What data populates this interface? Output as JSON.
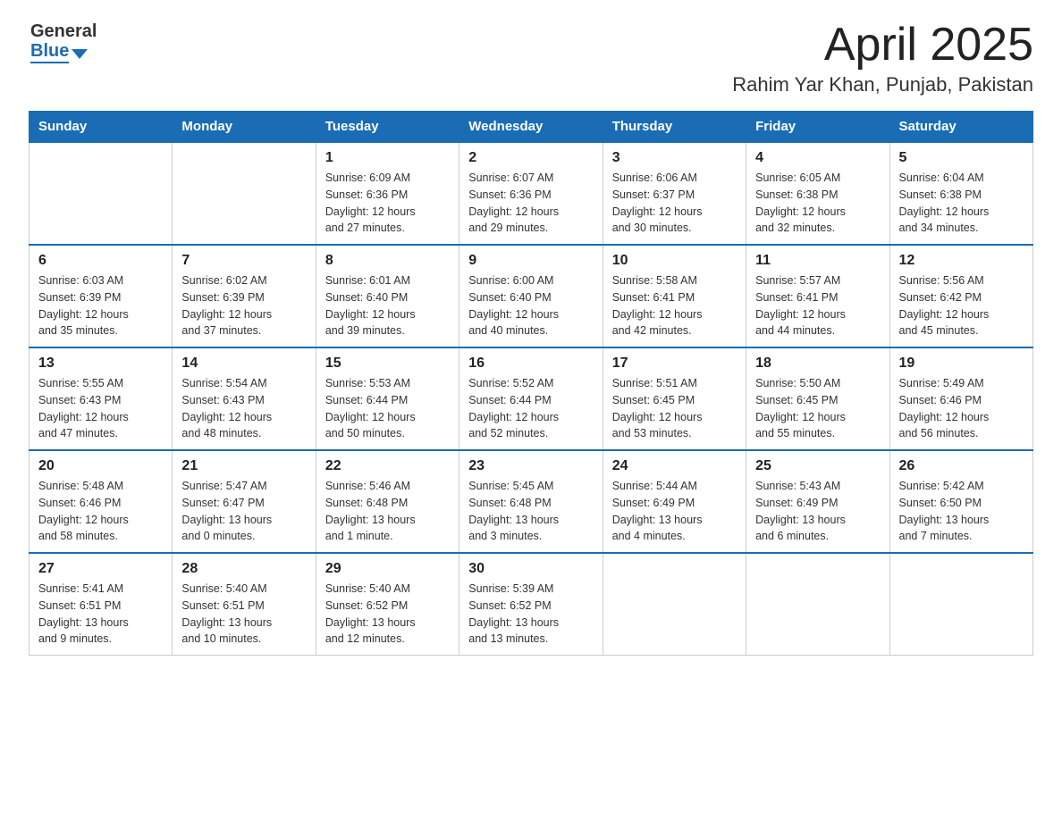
{
  "header": {
    "logo_general": "General",
    "logo_blue": "Blue",
    "month_title": "April 2025",
    "location": "Rahim Yar Khan, Punjab, Pakistan"
  },
  "calendar": {
    "days_of_week": [
      "Sunday",
      "Monday",
      "Tuesday",
      "Wednesday",
      "Thursday",
      "Friday",
      "Saturday"
    ],
    "weeks": [
      [
        {
          "day": "",
          "info": ""
        },
        {
          "day": "",
          "info": ""
        },
        {
          "day": "1",
          "info": "Sunrise: 6:09 AM\nSunset: 6:36 PM\nDaylight: 12 hours\nand 27 minutes."
        },
        {
          "day": "2",
          "info": "Sunrise: 6:07 AM\nSunset: 6:36 PM\nDaylight: 12 hours\nand 29 minutes."
        },
        {
          "day": "3",
          "info": "Sunrise: 6:06 AM\nSunset: 6:37 PM\nDaylight: 12 hours\nand 30 minutes."
        },
        {
          "day": "4",
          "info": "Sunrise: 6:05 AM\nSunset: 6:38 PM\nDaylight: 12 hours\nand 32 minutes."
        },
        {
          "day": "5",
          "info": "Sunrise: 6:04 AM\nSunset: 6:38 PM\nDaylight: 12 hours\nand 34 minutes."
        }
      ],
      [
        {
          "day": "6",
          "info": "Sunrise: 6:03 AM\nSunset: 6:39 PM\nDaylight: 12 hours\nand 35 minutes."
        },
        {
          "day": "7",
          "info": "Sunrise: 6:02 AM\nSunset: 6:39 PM\nDaylight: 12 hours\nand 37 minutes."
        },
        {
          "day": "8",
          "info": "Sunrise: 6:01 AM\nSunset: 6:40 PM\nDaylight: 12 hours\nand 39 minutes."
        },
        {
          "day": "9",
          "info": "Sunrise: 6:00 AM\nSunset: 6:40 PM\nDaylight: 12 hours\nand 40 minutes."
        },
        {
          "day": "10",
          "info": "Sunrise: 5:58 AM\nSunset: 6:41 PM\nDaylight: 12 hours\nand 42 minutes."
        },
        {
          "day": "11",
          "info": "Sunrise: 5:57 AM\nSunset: 6:41 PM\nDaylight: 12 hours\nand 44 minutes."
        },
        {
          "day": "12",
          "info": "Sunrise: 5:56 AM\nSunset: 6:42 PM\nDaylight: 12 hours\nand 45 minutes."
        }
      ],
      [
        {
          "day": "13",
          "info": "Sunrise: 5:55 AM\nSunset: 6:43 PM\nDaylight: 12 hours\nand 47 minutes."
        },
        {
          "day": "14",
          "info": "Sunrise: 5:54 AM\nSunset: 6:43 PM\nDaylight: 12 hours\nand 48 minutes."
        },
        {
          "day": "15",
          "info": "Sunrise: 5:53 AM\nSunset: 6:44 PM\nDaylight: 12 hours\nand 50 minutes."
        },
        {
          "day": "16",
          "info": "Sunrise: 5:52 AM\nSunset: 6:44 PM\nDaylight: 12 hours\nand 52 minutes."
        },
        {
          "day": "17",
          "info": "Sunrise: 5:51 AM\nSunset: 6:45 PM\nDaylight: 12 hours\nand 53 minutes."
        },
        {
          "day": "18",
          "info": "Sunrise: 5:50 AM\nSunset: 6:45 PM\nDaylight: 12 hours\nand 55 minutes."
        },
        {
          "day": "19",
          "info": "Sunrise: 5:49 AM\nSunset: 6:46 PM\nDaylight: 12 hours\nand 56 minutes."
        }
      ],
      [
        {
          "day": "20",
          "info": "Sunrise: 5:48 AM\nSunset: 6:46 PM\nDaylight: 12 hours\nand 58 minutes."
        },
        {
          "day": "21",
          "info": "Sunrise: 5:47 AM\nSunset: 6:47 PM\nDaylight: 13 hours\nand 0 minutes."
        },
        {
          "day": "22",
          "info": "Sunrise: 5:46 AM\nSunset: 6:48 PM\nDaylight: 13 hours\nand 1 minute."
        },
        {
          "day": "23",
          "info": "Sunrise: 5:45 AM\nSunset: 6:48 PM\nDaylight: 13 hours\nand 3 minutes."
        },
        {
          "day": "24",
          "info": "Sunrise: 5:44 AM\nSunset: 6:49 PM\nDaylight: 13 hours\nand 4 minutes."
        },
        {
          "day": "25",
          "info": "Sunrise: 5:43 AM\nSunset: 6:49 PM\nDaylight: 13 hours\nand 6 minutes."
        },
        {
          "day": "26",
          "info": "Sunrise: 5:42 AM\nSunset: 6:50 PM\nDaylight: 13 hours\nand 7 minutes."
        }
      ],
      [
        {
          "day": "27",
          "info": "Sunrise: 5:41 AM\nSunset: 6:51 PM\nDaylight: 13 hours\nand 9 minutes."
        },
        {
          "day": "28",
          "info": "Sunrise: 5:40 AM\nSunset: 6:51 PM\nDaylight: 13 hours\nand 10 minutes."
        },
        {
          "day": "29",
          "info": "Sunrise: 5:40 AM\nSunset: 6:52 PM\nDaylight: 13 hours\nand 12 minutes."
        },
        {
          "day": "30",
          "info": "Sunrise: 5:39 AM\nSunset: 6:52 PM\nDaylight: 13 hours\nand 13 minutes."
        },
        {
          "day": "",
          "info": ""
        },
        {
          "day": "",
          "info": ""
        },
        {
          "day": "",
          "info": ""
        }
      ]
    ]
  }
}
